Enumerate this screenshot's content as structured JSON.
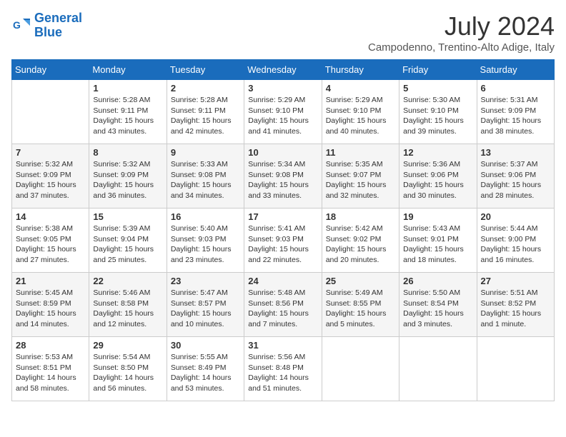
{
  "app": {
    "name": "GeneralBlue",
    "logo_color": "#1a6cbc"
  },
  "header": {
    "month": "July 2024",
    "location": "Campodenno, Trentino-Alto Adige, Italy"
  },
  "days_of_week": [
    "Sunday",
    "Monday",
    "Tuesday",
    "Wednesday",
    "Thursday",
    "Friday",
    "Saturday"
  ],
  "weeks": [
    [
      {
        "day": "",
        "info": ""
      },
      {
        "day": "1",
        "info": "Sunrise: 5:28 AM\nSunset: 9:11 PM\nDaylight: 15 hours\nand 43 minutes."
      },
      {
        "day": "2",
        "info": "Sunrise: 5:28 AM\nSunset: 9:11 PM\nDaylight: 15 hours\nand 42 minutes."
      },
      {
        "day": "3",
        "info": "Sunrise: 5:29 AM\nSunset: 9:10 PM\nDaylight: 15 hours\nand 41 minutes."
      },
      {
        "day": "4",
        "info": "Sunrise: 5:29 AM\nSunset: 9:10 PM\nDaylight: 15 hours\nand 40 minutes."
      },
      {
        "day": "5",
        "info": "Sunrise: 5:30 AM\nSunset: 9:10 PM\nDaylight: 15 hours\nand 39 minutes."
      },
      {
        "day": "6",
        "info": "Sunrise: 5:31 AM\nSunset: 9:09 PM\nDaylight: 15 hours\nand 38 minutes."
      }
    ],
    [
      {
        "day": "7",
        "info": "Sunrise: 5:32 AM\nSunset: 9:09 PM\nDaylight: 15 hours\nand 37 minutes."
      },
      {
        "day": "8",
        "info": "Sunrise: 5:32 AM\nSunset: 9:09 PM\nDaylight: 15 hours\nand 36 minutes."
      },
      {
        "day": "9",
        "info": "Sunrise: 5:33 AM\nSunset: 9:08 PM\nDaylight: 15 hours\nand 34 minutes."
      },
      {
        "day": "10",
        "info": "Sunrise: 5:34 AM\nSunset: 9:08 PM\nDaylight: 15 hours\nand 33 minutes."
      },
      {
        "day": "11",
        "info": "Sunrise: 5:35 AM\nSunset: 9:07 PM\nDaylight: 15 hours\nand 32 minutes."
      },
      {
        "day": "12",
        "info": "Sunrise: 5:36 AM\nSunset: 9:06 PM\nDaylight: 15 hours\nand 30 minutes."
      },
      {
        "day": "13",
        "info": "Sunrise: 5:37 AM\nSunset: 9:06 PM\nDaylight: 15 hours\nand 28 minutes."
      }
    ],
    [
      {
        "day": "14",
        "info": "Sunrise: 5:38 AM\nSunset: 9:05 PM\nDaylight: 15 hours\nand 27 minutes."
      },
      {
        "day": "15",
        "info": "Sunrise: 5:39 AM\nSunset: 9:04 PM\nDaylight: 15 hours\nand 25 minutes."
      },
      {
        "day": "16",
        "info": "Sunrise: 5:40 AM\nSunset: 9:03 PM\nDaylight: 15 hours\nand 23 minutes."
      },
      {
        "day": "17",
        "info": "Sunrise: 5:41 AM\nSunset: 9:03 PM\nDaylight: 15 hours\nand 22 minutes."
      },
      {
        "day": "18",
        "info": "Sunrise: 5:42 AM\nSunset: 9:02 PM\nDaylight: 15 hours\nand 20 minutes."
      },
      {
        "day": "19",
        "info": "Sunrise: 5:43 AM\nSunset: 9:01 PM\nDaylight: 15 hours\nand 18 minutes."
      },
      {
        "day": "20",
        "info": "Sunrise: 5:44 AM\nSunset: 9:00 PM\nDaylight: 15 hours\nand 16 minutes."
      }
    ],
    [
      {
        "day": "21",
        "info": "Sunrise: 5:45 AM\nSunset: 8:59 PM\nDaylight: 15 hours\nand 14 minutes."
      },
      {
        "day": "22",
        "info": "Sunrise: 5:46 AM\nSunset: 8:58 PM\nDaylight: 15 hours\nand 12 minutes."
      },
      {
        "day": "23",
        "info": "Sunrise: 5:47 AM\nSunset: 8:57 PM\nDaylight: 15 hours\nand 10 minutes."
      },
      {
        "day": "24",
        "info": "Sunrise: 5:48 AM\nSunset: 8:56 PM\nDaylight: 15 hours\nand 7 minutes."
      },
      {
        "day": "25",
        "info": "Sunrise: 5:49 AM\nSunset: 8:55 PM\nDaylight: 15 hours\nand 5 minutes."
      },
      {
        "day": "26",
        "info": "Sunrise: 5:50 AM\nSunset: 8:54 PM\nDaylight: 15 hours\nand 3 minutes."
      },
      {
        "day": "27",
        "info": "Sunrise: 5:51 AM\nSunset: 8:52 PM\nDaylight: 15 hours\nand 1 minute."
      }
    ],
    [
      {
        "day": "28",
        "info": "Sunrise: 5:53 AM\nSunset: 8:51 PM\nDaylight: 14 hours\nand 58 minutes."
      },
      {
        "day": "29",
        "info": "Sunrise: 5:54 AM\nSunset: 8:50 PM\nDaylight: 14 hours\nand 56 minutes."
      },
      {
        "day": "30",
        "info": "Sunrise: 5:55 AM\nSunset: 8:49 PM\nDaylight: 14 hours\nand 53 minutes."
      },
      {
        "day": "31",
        "info": "Sunrise: 5:56 AM\nSunset: 8:48 PM\nDaylight: 14 hours\nand 51 minutes."
      },
      {
        "day": "",
        "info": ""
      },
      {
        "day": "",
        "info": ""
      },
      {
        "day": "",
        "info": ""
      }
    ]
  ]
}
